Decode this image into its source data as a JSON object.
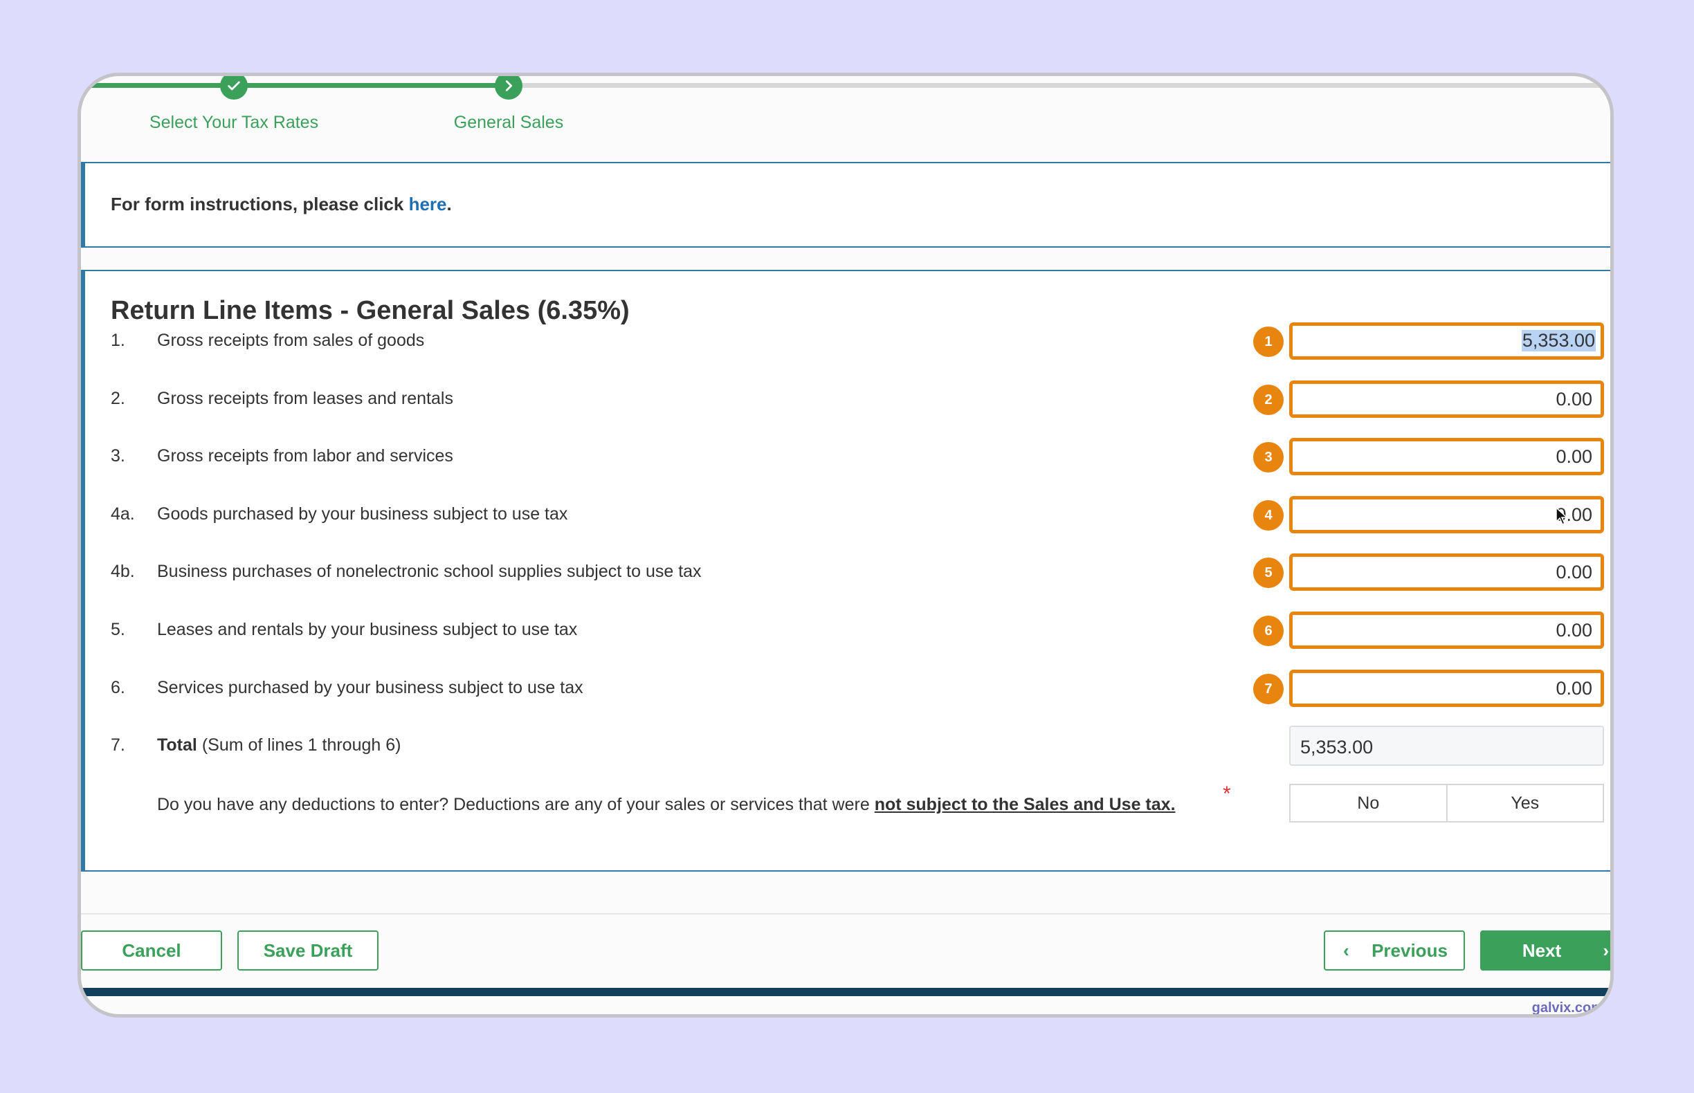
{
  "stepper": {
    "steps": [
      {
        "label": "Select Your Tax Rates",
        "state": "completed",
        "icon": "check-icon"
      },
      {
        "label": "General Sales",
        "state": "current",
        "icon": "chevron-right-icon"
      }
    ]
  },
  "instructions": {
    "text": "For form instructions, please click ",
    "link_label": "here",
    "suffix": "."
  },
  "section": {
    "title": "Return Line Items - General Sales (6.35%)",
    "lines": [
      {
        "num": "1.",
        "label": "Gross receipts from sales of goods",
        "badge": "1",
        "value": "5,353.00"
      },
      {
        "num": "2.",
        "label": "Gross receipts from leases and rentals",
        "badge": "2",
        "value": "0.00"
      },
      {
        "num": "3.",
        "label": "Gross receipts from labor and services",
        "badge": "3",
        "value": "0.00"
      },
      {
        "num": "4a.",
        "label": "Goods purchased by your business subject to use tax",
        "badge": "4",
        "value": "0.00"
      },
      {
        "num": "4b.",
        "label": "Business purchases of nonelectronic school supplies subject to use tax",
        "badge": "5",
        "value": "0.00"
      },
      {
        "num": "5.",
        "label": "Leases and rentals by your business subject to use tax",
        "badge": "6",
        "value": "0.00"
      },
      {
        "num": "6.",
        "label": "Services purchased by your business subject to use tax",
        "badge": "7",
        "value": "0.00"
      }
    ],
    "total": {
      "num": "7.",
      "label_bold": "Total",
      "label_rest": " (Sum of lines 1 through 6)",
      "value": "5,353.00"
    },
    "deductions": {
      "question": "Do you have any deductions to enter? Deductions are any of your sales or services that were ",
      "question_emphasis": "not subject to the Sales and Use tax.",
      "required_mark": "*",
      "options": [
        "No",
        "Yes"
      ]
    }
  },
  "footer": {
    "cancel_label": "Cancel",
    "save_draft_label": "Save Draft",
    "previous_label": "Previous",
    "next_label": "Next"
  },
  "watermark": "galvix.com",
  "colors": {
    "accent_green": "#3aa05a",
    "highlight_orange": "#e8850f",
    "panel_blue": "#2f7aa8",
    "background": "#dedcfc"
  }
}
